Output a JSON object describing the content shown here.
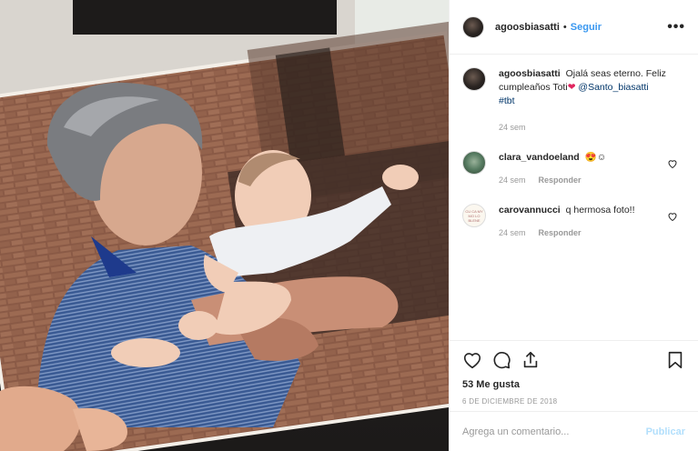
{
  "header": {
    "username": "agoosbiasatti",
    "separator": "•",
    "follow_label": "Seguir",
    "more_label": "•••"
  },
  "caption": {
    "username": "agoosbiasatti",
    "text": "Ojalá seas eterno. Feliz cumpleaños Toti",
    "heart_emoji": "❤",
    "mention": "@Santo_biasatti",
    "hashtag": "#tbt",
    "time": "24 sem"
  },
  "comments": [
    {
      "username": "clara_vandoeland",
      "text": "😍☺",
      "time": "24 sem",
      "reply_label": "Responder",
      "avatar_icon": "profile-photo"
    },
    {
      "username": "carovannucci",
      "text": "q hermosa foto!!",
      "time": "24 sem",
      "reply_label": "Responder",
      "avatar_icon": "profile-logo",
      "avatar_text": "CU CA MY MO LO BLENE"
    }
  ],
  "actions": {
    "icons": [
      "heart-icon",
      "comment-icon",
      "share-icon",
      "bookmark-icon"
    ],
    "likes": "53 Me gusta",
    "date": "6 DE DICIEMBRE DE 2018"
  },
  "add_comment": {
    "placeholder": "Agrega un comentario...",
    "publish_label": "Publicar"
  },
  "colors": {
    "link": "#3897f0",
    "publish_disabled": "#b2dffc",
    "muted": "#999999",
    "text": "#262626"
  }
}
